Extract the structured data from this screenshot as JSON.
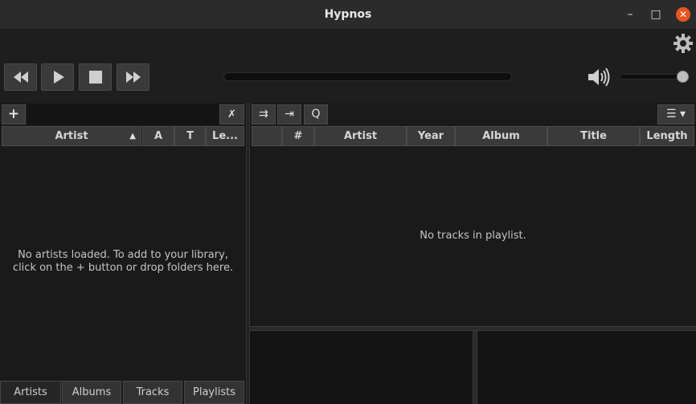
{
  "window": {
    "title": "Hypnos",
    "minimize": "–",
    "maximize": "□",
    "close": "✕"
  },
  "icons": {
    "settings": "gear-icon",
    "previous": "rewind-icon",
    "play": "play-icon",
    "stop": "stop-icon",
    "next": "fast-forward-icon",
    "volume": "speaker-icon"
  },
  "transport": {
    "progress": 0,
    "volume": 1.0
  },
  "library": {
    "add_label": "+",
    "clear_label": "✗",
    "filter_value": "",
    "columns": [
      "Artist",
      "A",
      "T",
      "Le..."
    ],
    "sort_indicator": "▲",
    "empty_line1": "No artists loaded. To add to your library,",
    "empty_line2": "click on the + button or drop folders here.",
    "tabs": [
      "Artists",
      "Albums",
      "Tracks",
      "Playlists"
    ]
  },
  "playlist": {
    "buttons": [
      "⇉",
      "⇥",
      "Q"
    ],
    "menu_label": "☰ ▾",
    "columns": [
      "",
      "#",
      "Artist",
      "Year",
      "Album",
      "Title",
      "Length"
    ],
    "empty_text": "No tracks in playlist."
  },
  "colors": {
    "close_button": "#e95420",
    "background": "#1e1e1e",
    "header": "#3a3a3a"
  }
}
